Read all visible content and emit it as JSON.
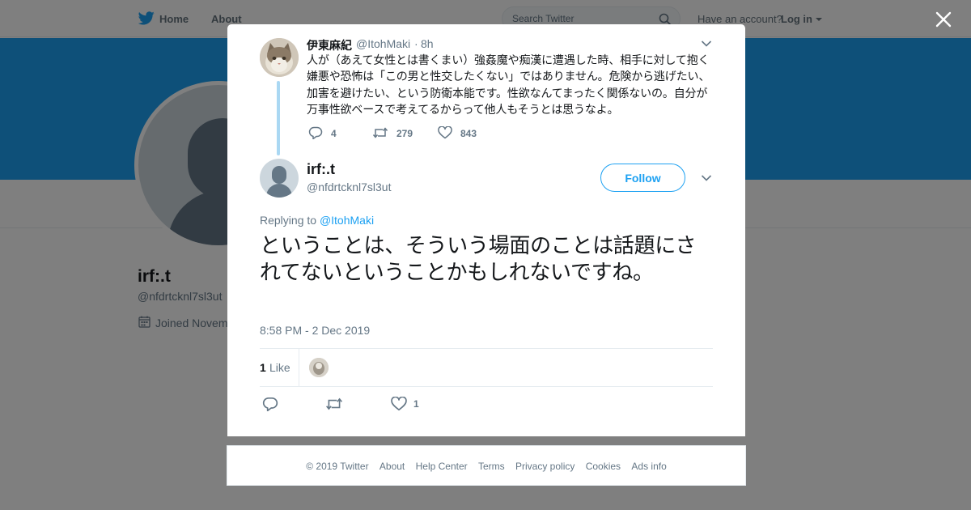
{
  "topnav": {
    "home_label": "Home",
    "about_label": "About",
    "search_placeholder": "Search Twitter",
    "have_account": "Have an account?",
    "login_label": "Log in",
    "brand_color": "#1da1f2"
  },
  "profile": {
    "name": "irf:.t",
    "handle": "@nfdrtcknl7sl3ut",
    "joined": "Joined Novem"
  },
  "modal": {
    "parent": {
      "fullname": "伊東麻紀",
      "screen_name": "@ItohMaki",
      "dot": "·",
      "time": "8h",
      "text": "人が（あえて女性とは書くまい）強姦魔や痴漢に遭遇した時、相手に対して抱く嫌悪や恐怖は「この男と性交したくない」ではありません。危険から逃げたい、加害を避けたい、という防衛本能です。性欲なんてまったく関係ないの。自分が万事性欲ベースで考えてるからって他人もそうとは思うなよ。",
      "replies": "4",
      "retweets": "279",
      "likes": "843"
    },
    "main": {
      "name": "irf:.t",
      "handle": "@nfdrtcknl7sl3ut",
      "follow_label": "Follow",
      "replying_prefix": "Replying to",
      "replying_to": "@ItohMaki",
      "text": "ということは、そういう場面のことは話題にされてないということかもしれないですね。",
      "date": "8:58 PM - 2 Dec 2019",
      "like_count": "1",
      "like_label": "Like",
      "action_like_count": "1"
    }
  },
  "footer": {
    "items": [
      "© 2019 Twitter",
      "About",
      "Help Center",
      "Terms",
      "Privacy policy",
      "Cookies",
      "Ads info"
    ]
  },
  "icons": {
    "twitter-bird": "twitter-bird-icon",
    "search": "search-icon",
    "close": "close-icon",
    "chevron": "chevron-down-icon",
    "reply": "reply-icon",
    "retweet": "retweet-icon",
    "like": "heart-icon",
    "calendar": "calendar-icon"
  }
}
